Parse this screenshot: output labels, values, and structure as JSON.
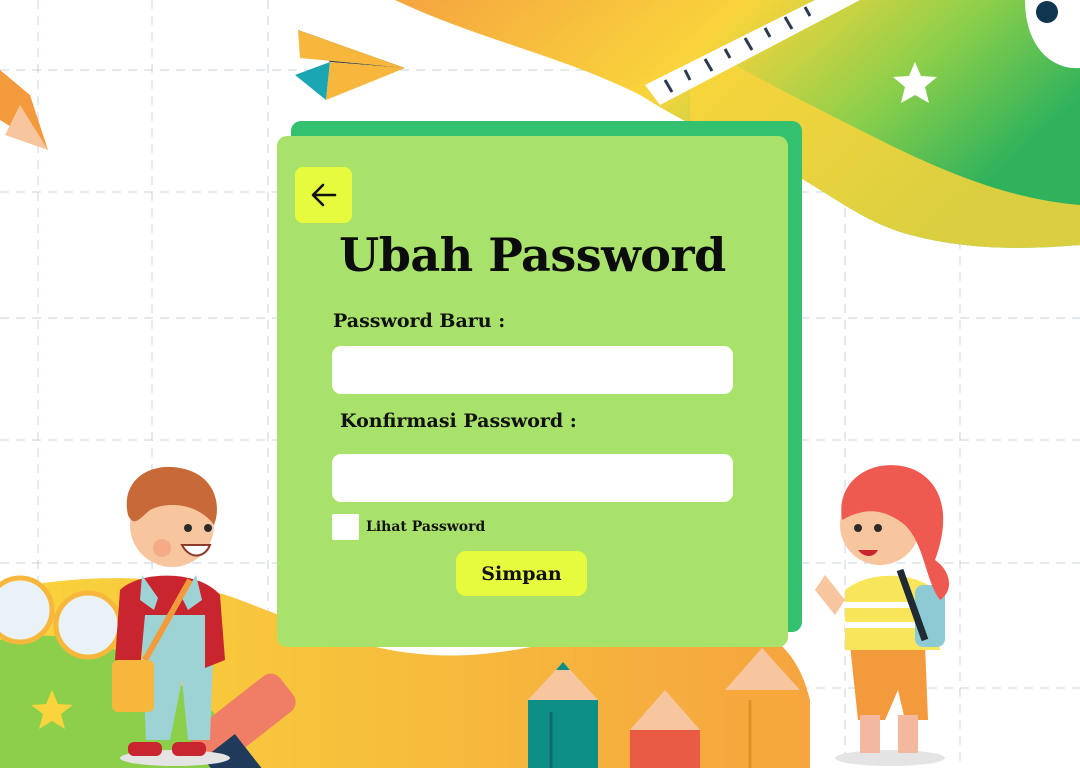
{
  "page": {
    "title": "Ubah Password"
  },
  "form": {
    "new_password_label": "Password Baru :",
    "new_password_value": "",
    "confirm_password_label": "Konfirmasi Password :",
    "confirm_password_value": "",
    "show_password_label": "Lihat Password",
    "show_password_checked": false,
    "save_label": "Simpan"
  },
  "icons": {
    "back": "arrow-left-icon"
  },
  "colors": {
    "card": "#a9e26a",
    "card_shadow": "#33c16f",
    "button": "#e6fb3d",
    "input": "#ffffff"
  }
}
